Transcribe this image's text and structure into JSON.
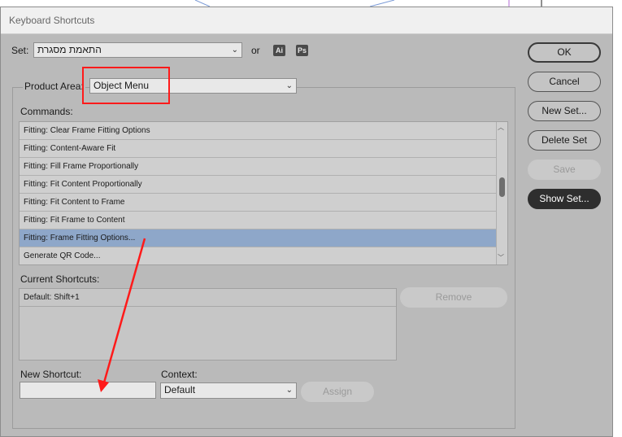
{
  "window": {
    "title": "Keyboard Shortcuts"
  },
  "set": {
    "label": "Set:",
    "value": "התאמת מסגרת",
    "or_label": "or",
    "app_badges": [
      "Ai",
      "Ps"
    ]
  },
  "product_area": {
    "label": "Product Area:",
    "value": "Object Menu"
  },
  "commands": {
    "label": "Commands:",
    "items": [
      "Fitting: Clear Frame Fitting Options",
      "Fitting: Content-Aware Fit",
      "Fitting: Fill Frame Proportionally",
      "Fitting: Fit Content Proportionally",
      "Fitting: Fit Content to Frame",
      "Fitting: Fit Frame to Content",
      "Fitting: Frame Fitting Options...",
      "Generate QR Code..."
    ],
    "selected_index": 6
  },
  "current_shortcuts": {
    "label": "Current Shortcuts:",
    "items": [
      "Default: Shift+1"
    ],
    "remove_label": "Remove"
  },
  "new_shortcut": {
    "label": "New Shortcut:",
    "value": ""
  },
  "context": {
    "label": "Context:",
    "value": "Default",
    "assign_label": "Assign"
  },
  "buttons": {
    "ok": "OK",
    "cancel": "Cancel",
    "new_set": "New Set...",
    "delete_set": "Delete Set",
    "save": "Save",
    "show_set": "Show Set..."
  },
  "icons": {
    "dropdown": "chevron-down-icon",
    "scroll_up": "chevron-up-icon",
    "scroll_down": "chevron-down-icon"
  },
  "colors": {
    "selection": "#8ea7c9",
    "annotation": "#ff1a1a",
    "dialog_bg": "#bababa"
  }
}
